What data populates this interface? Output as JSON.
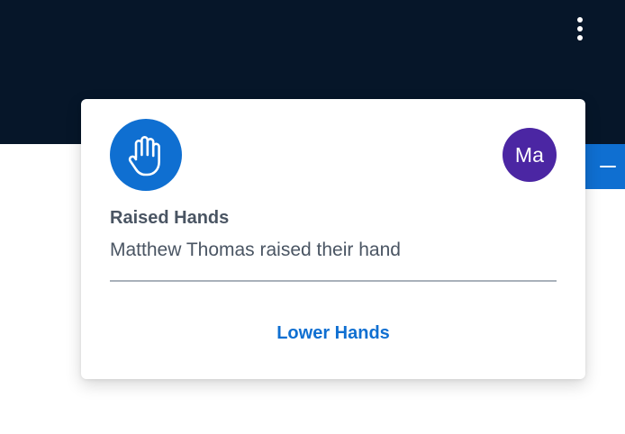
{
  "header": {
    "menu_icon": "kebab-menu-icon",
    "background": "#061629"
  },
  "side_tab": {
    "icon": "minimize-icon",
    "color": "#0f6fd1"
  },
  "notification": {
    "icon": "raised-hand-icon",
    "icon_color": "#0f6fd1",
    "avatar_initials": "Ma",
    "avatar_color": "#4b26a3",
    "title": "Raised Hands",
    "message": "Matthew Thomas raised their hand",
    "action_label": "Lower Hands",
    "action_color": "#0f6fd1"
  }
}
